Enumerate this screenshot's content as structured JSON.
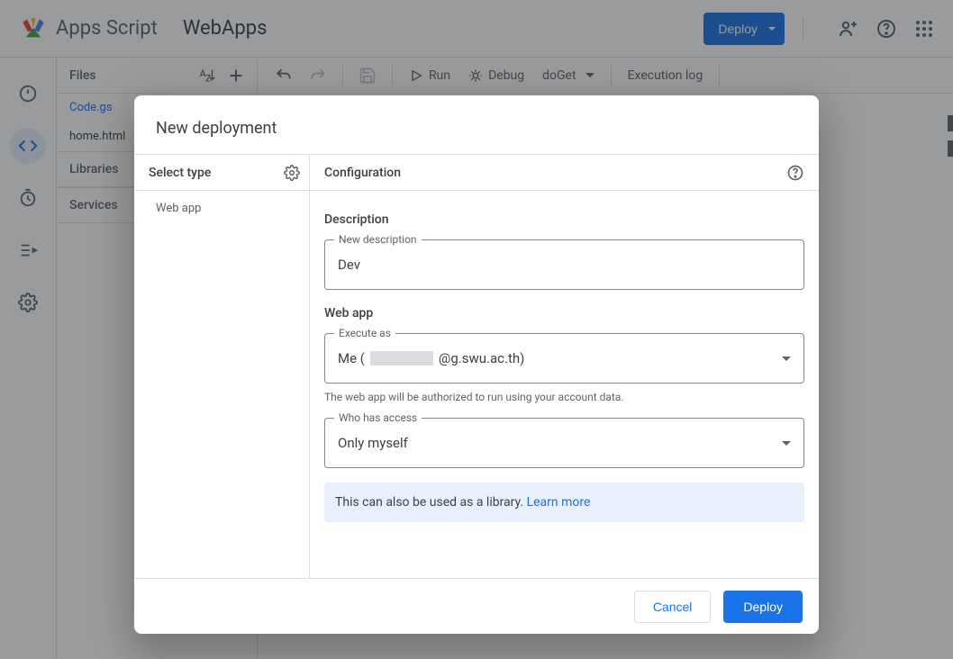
{
  "header": {
    "app_name": "Apps Script",
    "project_name": "WebApps",
    "deploy_button": "Deploy"
  },
  "files_panel": {
    "header": "Files",
    "items": [
      {
        "name": "Code.gs",
        "active": true
      },
      {
        "name": "home.html",
        "active": false
      }
    ],
    "libraries_label": "Libraries",
    "services_label": "Services"
  },
  "toolbar": {
    "run_label": "Run",
    "debug_label": "Debug",
    "function_selected": "doGet",
    "execution_log_label": "Execution log"
  },
  "dialog": {
    "title": "New deployment",
    "left": {
      "header": "Select type",
      "type_item": "Web app"
    },
    "right": {
      "header": "Configuration",
      "description_section": "Description",
      "description_float": "New description",
      "description_value": "Dev",
      "webapp_section": "Web app",
      "execute_as_float": "Execute as",
      "execute_as_prefix": "Me (",
      "execute_as_suffix": "@g.swu.ac.th)",
      "execute_as_helper": "The web app will be authorized to run using your account data.",
      "access_float": "Who has access",
      "access_value": "Only myself",
      "info_text": "This can also be used as a library. ",
      "info_link": "Learn more"
    },
    "footer": {
      "cancel": "Cancel",
      "deploy": "Deploy"
    }
  }
}
